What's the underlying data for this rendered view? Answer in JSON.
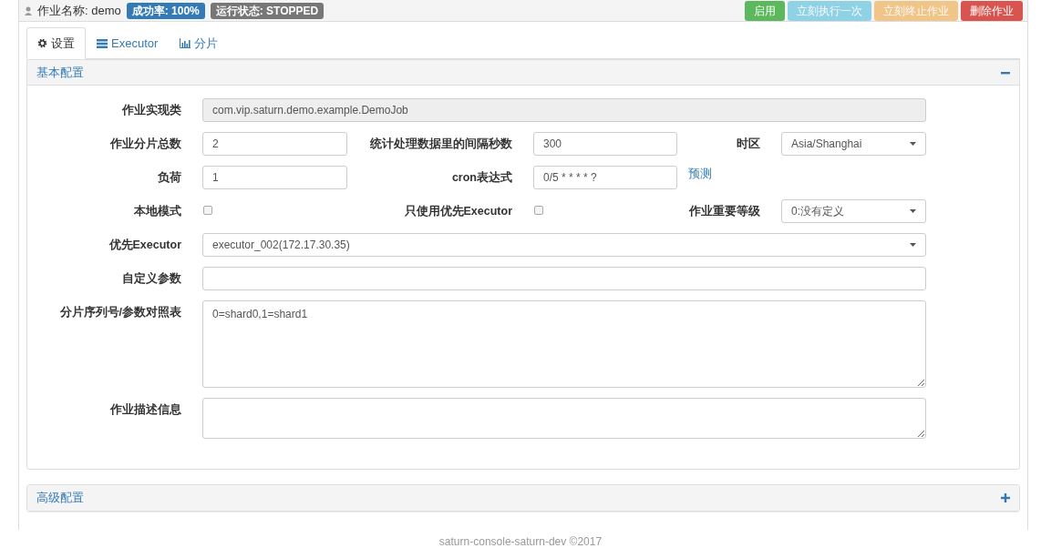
{
  "header": {
    "job_label": "作业名称:",
    "job_name": "demo",
    "badges": [
      {
        "text": "成功率: 100%",
        "color": "#337ab7"
      },
      {
        "text": "运行状态: STOPPED",
        "color": "#777777"
      }
    ],
    "buttons": [
      {
        "label": "启用",
        "kind": "success",
        "disabled": false
      },
      {
        "label": "立刻执行一次",
        "kind": "info",
        "disabled": true
      },
      {
        "label": "立刻终止作业",
        "kind": "warning",
        "disabled": true
      },
      {
        "label": "删除作业",
        "kind": "danger",
        "disabled": false
      }
    ]
  },
  "tabs": [
    {
      "label": "设置",
      "selected": true
    },
    {
      "label": "Executor",
      "selected": false
    },
    {
      "label": "分片",
      "selected": false
    }
  ],
  "basic_panel": {
    "title": "基本配置",
    "expanded": true,
    "rows": [
      [
        {
          "label": "作业实现类",
          "kind": "readonly",
          "value": "com.vip.saturn.demo.example.DemoJob"
        }
      ],
      [
        {
          "label": "作业分片总数",
          "kind": "text",
          "value": "2"
        },
        {
          "label": "统计处理数据里的间隔秒数",
          "kind": "text",
          "value": "300"
        },
        {
          "label": "时区",
          "kind": "select",
          "value": "Asia/Shanghai"
        }
      ],
      [
        {
          "label": "负荷",
          "kind": "text",
          "value": "1"
        },
        {
          "label": "cron表达式",
          "kind": "text",
          "value": "0/5 * * * * ?"
        },
        {
          "kind": "link",
          "value": "预测"
        }
      ],
      [
        {
          "label": "本地模式",
          "kind": "checkbox",
          "checked": false
        },
        {
          "label": "只使用优先Executor",
          "kind": "checkbox",
          "checked": false
        },
        {
          "label": "作业重要等级",
          "kind": "select",
          "value": "0:没有定义"
        }
      ],
      [
        {
          "label": "优先Executor",
          "kind": "select",
          "value": "executor_002(172.17.30.35)"
        }
      ],
      [
        {
          "label": "自定义参数",
          "kind": "text"
        }
      ],
      [
        {
          "label": "分片序列号/参数对照表",
          "kind": "textarea",
          "value": "0=shard0,1=shard1",
          "tall": true
        }
      ],
      [
        {
          "label": "作业描述信息",
          "kind": "textarea",
          "tall": false
        }
      ]
    ]
  },
  "advanced_panel": {
    "title": "高级配置",
    "expanded": false
  },
  "footer": "saturn-console-saturn-dev ©2017"
}
